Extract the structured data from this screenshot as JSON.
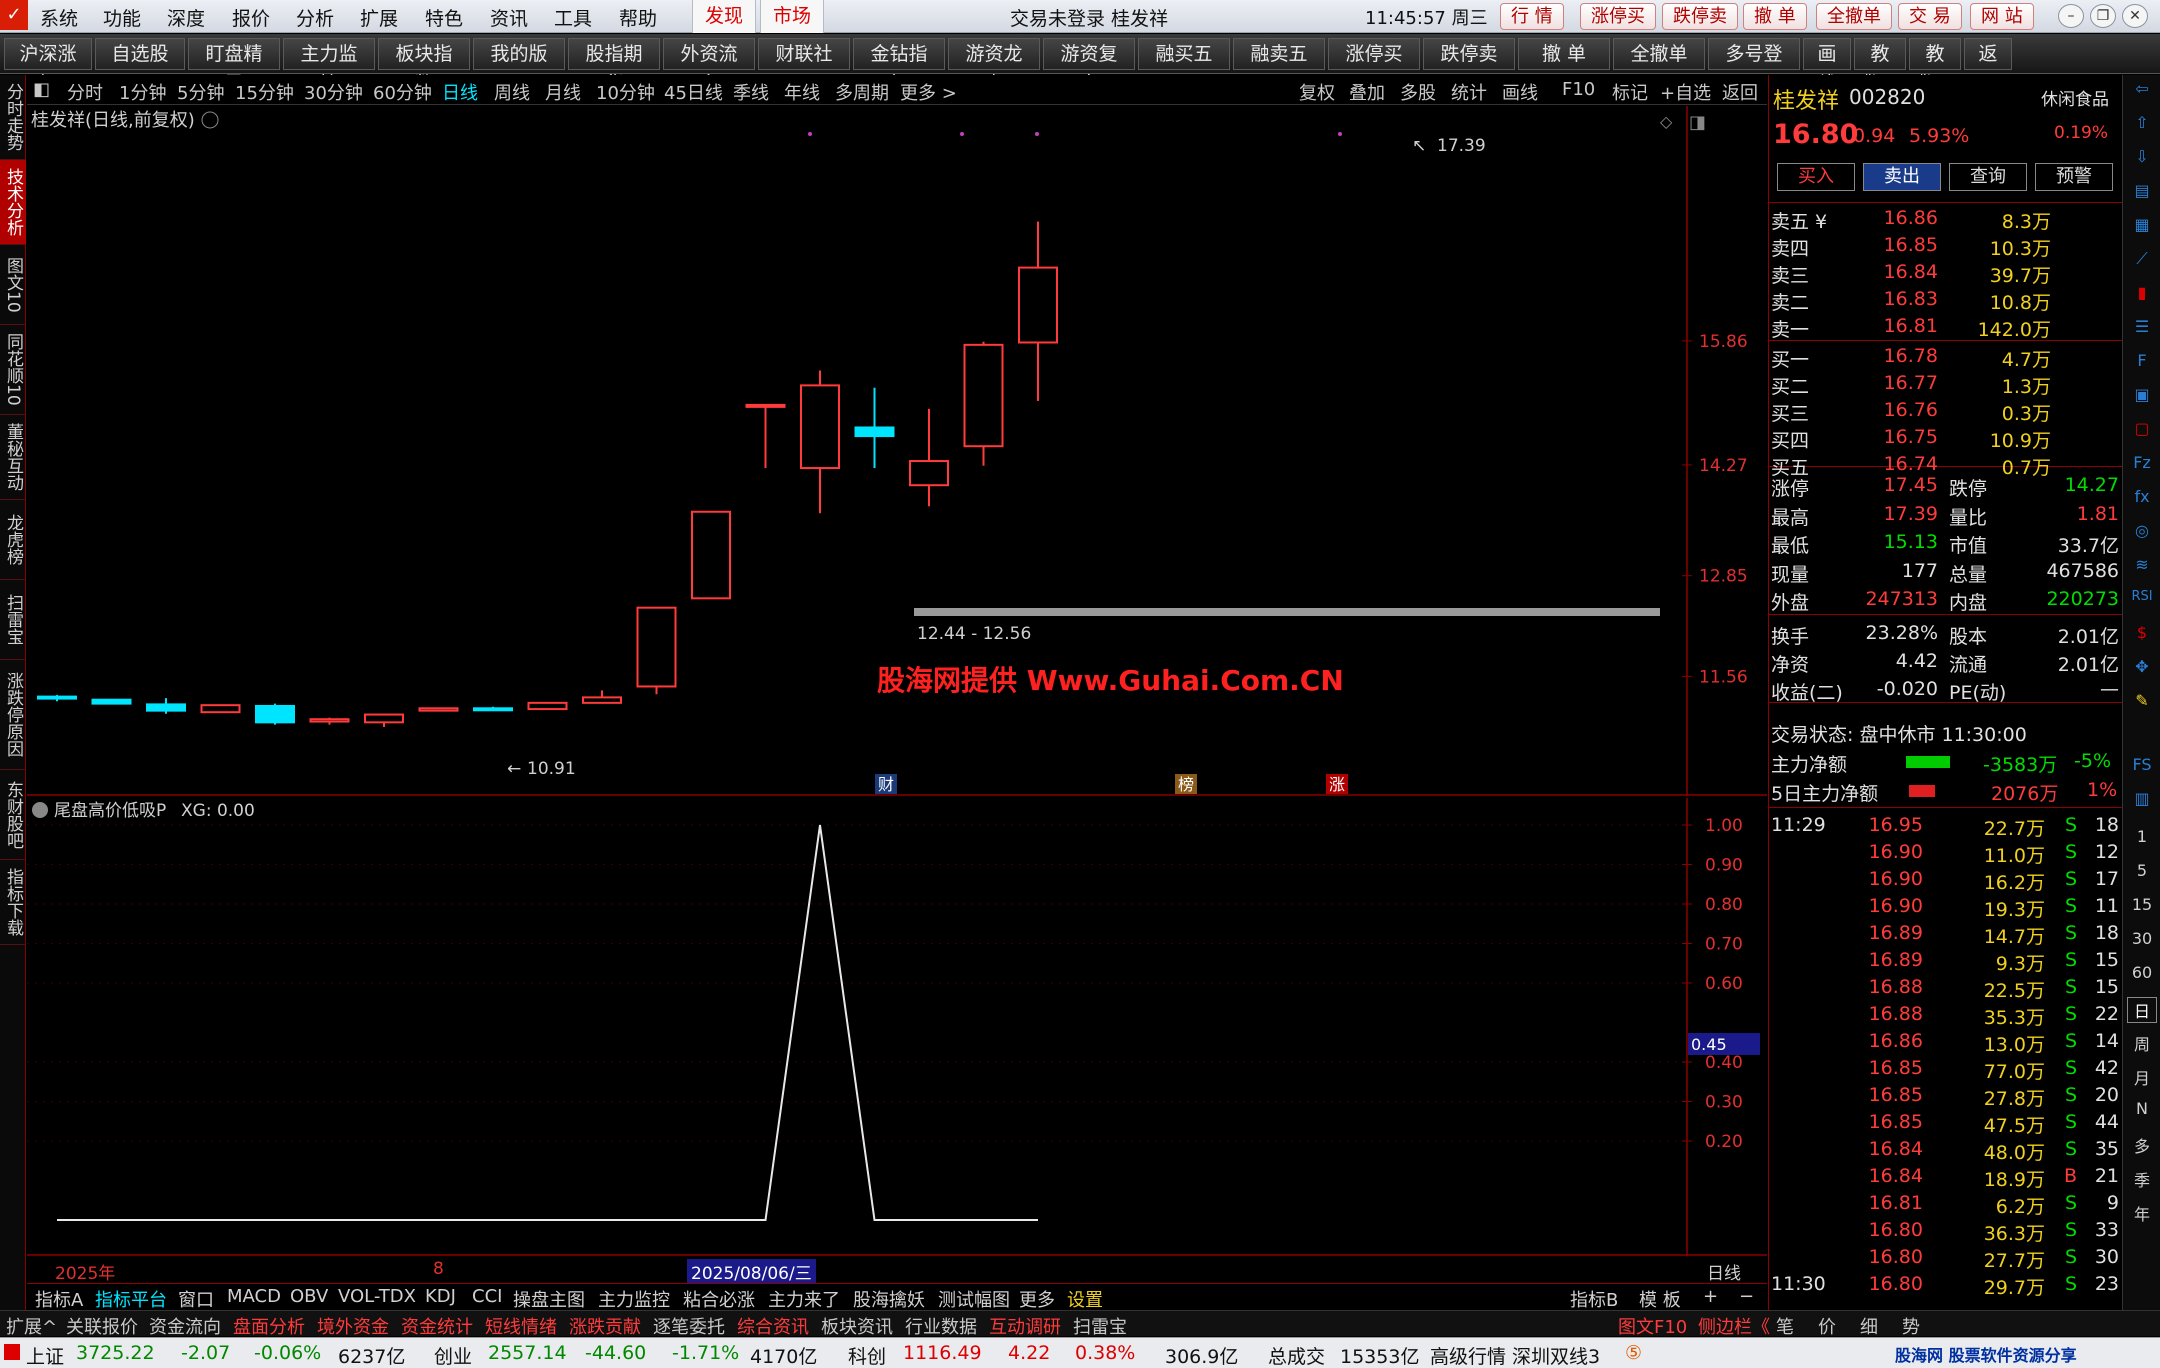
{
  "menubar": {
    "items": [
      "系统",
      "功能",
      "深度",
      "报价",
      "分析",
      "扩展",
      "特色",
      "资讯",
      "工具",
      "帮助"
    ],
    "highlight": [
      "发现",
      "市场"
    ],
    "center": "交易未登录  桂发祥",
    "clock": "11:45:57 周三",
    "trade_buttons": [
      "行  情",
      "涨停买",
      "跌停卖",
      "撤  单",
      "全撤单",
      "交  易",
      "网  站"
    ]
  },
  "toolbar": {
    "buttons": [
      "沪深涨幅",
      "自选股",
      "盯盘精灵",
      "主力监控",
      "板块指数",
      "我的版面",
      "股指期货",
      "外资流向",
      "财联社",
      "金钻指标",
      "游资龙虎",
      "游资复盘",
      "融买五",
      "融卖五",
      "涨停买",
      "跌停卖",
      "撤  单",
      "全撤单",
      "多号登录",
      "画线",
      "教鞭A",
      "教鞭B",
      "返回"
    ]
  },
  "left_tabs": [
    "分时走势",
    "技术分析",
    "图文10",
    "同花顺10",
    "董秘互动",
    "龙虎榜",
    "扫雷宝",
    "涨跌停原因",
    "东财股吧",
    "指标下载"
  ],
  "period_bar": {
    "periods": [
      "分时",
      "1分钟",
      "5分钟",
      "15分钟",
      "30分钟",
      "60分钟",
      "日线",
      "周线",
      "月线",
      "10分钟",
      "45日线",
      "季线",
      "年线",
      "多周期",
      "更多 >"
    ],
    "selected": "日线",
    "right": [
      "复权",
      "叠加",
      "多股",
      "统计",
      "画线",
      "F10",
      "标记",
      "+自选",
      "返回"
    ]
  },
  "main_chart": {
    "title": "桂发祥(日线,前复权)",
    "watermark": "股海网提供 Www.Guhai.Com.CN",
    "high_label": "17.39",
    "low_label": "10.91",
    "zone_label": "12.44 - 12.56",
    "markers": [
      "财",
      "榜",
      "涨"
    ],
    "y_ticks": [
      "15.86",
      "14.27",
      "12.85",
      "11.56"
    ]
  },
  "chart_data": {
    "type": "candlestick",
    "title": "桂发祥(日线,前复权)",
    "y_ticks": [
      15.86,
      14.27,
      12.85,
      11.56
    ],
    "candles": [
      {
        "o": 11.3,
        "h": 11.32,
        "l": 11.24,
        "c": 11.28,
        "color": "cyan"
      },
      {
        "o": 11.26,
        "h": 11.27,
        "l": 11.2,
        "c": 11.21,
        "color": "cyan"
      },
      {
        "o": 11.2,
        "h": 11.28,
        "l": 11.08,
        "c": 11.12,
        "color": "cyan"
      },
      {
        "o": 11.1,
        "h": 11.2,
        "l": 11.09,
        "c": 11.19,
        "color": "red"
      },
      {
        "o": 11.18,
        "h": 11.21,
        "l": 10.94,
        "c": 10.97,
        "color": "cyan"
      },
      {
        "o": 10.98,
        "h": 11.03,
        "l": 10.94,
        "c": 11.01,
        "color": "red"
      },
      {
        "o": 10.97,
        "h": 11.08,
        "l": 10.91,
        "c": 11.07,
        "color": "red"
      },
      {
        "o": 11.12,
        "h": 11.16,
        "l": 11.12,
        "c": 11.15,
        "color": "red"
      },
      {
        "o": 11.14,
        "h": 11.17,
        "l": 11.12,
        "c": 11.15,
        "color": "cyan"
      },
      {
        "o": 11.14,
        "h": 11.23,
        "l": 11.13,
        "c": 11.22,
        "color": "red"
      },
      {
        "o": 11.22,
        "h": 11.38,
        "l": 11.22,
        "c": 11.29,
        "color": "red"
      },
      {
        "o": 11.43,
        "h": 12.44,
        "l": 11.33,
        "c": 12.44,
        "color": "red"
      },
      {
        "o": 12.56,
        "h": 13.67,
        "l": 12.56,
        "c": 13.67,
        "color": "red"
      },
      {
        "o": 15.04,
        "h": 15.04,
        "l": 14.23,
        "c": 15.04,
        "color": "red"
      },
      {
        "o": 14.23,
        "h": 15.48,
        "l": 13.65,
        "c": 15.29,
        "color": "red"
      },
      {
        "o": 14.75,
        "h": 15.26,
        "l": 14.23,
        "c": 14.64,
        "color": "cyan"
      },
      {
        "o": 14.01,
        "h": 14.99,
        "l": 13.74,
        "c": 14.32,
        "color": "red"
      },
      {
        "o": 14.51,
        "h": 15.85,
        "l": 14.26,
        "c": 15.81,
        "color": "red"
      },
      {
        "o": 15.84,
        "h": 17.39,
        "l": 15.09,
        "c": 16.8,
        "color": "red"
      }
    ],
    "indicator": {
      "name": "尾盘高价低吸P",
      "label": "XG: 0.00",
      "y_ticks": [
        1.0,
        0.9,
        0.8,
        0.7,
        0.6,
        0.4,
        0.3,
        0.2
      ],
      "current": "0.45",
      "values": [
        0,
        0,
        0,
        0,
        0,
        0,
        0,
        0,
        0,
        0,
        0,
        0,
        0,
        0,
        1,
        0,
        0,
        0,
        0
      ]
    },
    "x_labels": [
      "2025年",
      "8",
      "2025/08/06/三"
    ]
  },
  "indicator_tabs": [
    "指标A",
    "指标平台",
    "窗口",
    "MACD",
    "OBV",
    "VOL-TDX",
    "KDJ",
    "CCI",
    "操盘主图",
    "主力监控",
    "粘合必涨",
    "主力来了",
    "股海擒妖",
    "测试幅图",
    "更多",
    "设置"
  ],
  "indicator_tabs_right": [
    "指标B",
    "模 板",
    "+",
    "−"
  ],
  "function_tabs": [
    "扩展^",
    "关联报价",
    "资金流向",
    "盘面分析",
    "境外资金",
    "资金统计",
    "短线情绪",
    "涨跌贡献",
    "逐笔委托",
    "综合资讯",
    "板块资讯",
    "行业数据",
    "互动调研",
    "扫雷宝"
  ],
  "function_tabs_right": [
    "图文F10",
    "侧边栏《",
    "笔",
    "价",
    "细",
    "势"
  ],
  "status_bar": {
    "sh_name": "上证",
    "sh_val": "3725.22",
    "sh_chg": "-2.07",
    "sh_pct": "-0.06%",
    "sh_amt": "6237亿",
    "cy_name": "创业",
    "cy_val": "2557.14",
    "cy_chg": "-44.60",
    "cy_pct": "-1.71%",
    "cy_amt": "4170亿",
    "kc_name": "科创",
    "kc_val": "1116.49",
    "kc_chg": "4.22",
    "kc_pct": "0.38%",
    "kc_amt": "306.9亿",
    "total_label": "总成交",
    "total_val": "15353亿",
    "feed": "高级行情  深圳双线3",
    "brand": "股海网  股票软件资源分享  www.Guhai.com.cn"
  },
  "quote": {
    "name": "桂发祥",
    "code": "002820",
    "sector": "休闲食品",
    "sector_pct": "0.19%",
    "price": "16.80",
    "change": "0.94",
    "pct": "5.93%",
    "buttons": [
      "买入",
      "卖出",
      "查询",
      "预警"
    ],
    "asks": [
      {
        "label": "卖五 ¥",
        "price": "16.86",
        "vol": "8.3万"
      },
      {
        "label": "卖四",
        "price": "16.85",
        "vol": "10.3万"
      },
      {
        "label": "卖三",
        "price": "16.84",
        "vol": "39.7万"
      },
      {
        "label": "卖二",
        "price": "16.83",
        "vol": "10.8万"
      },
      {
        "label": "卖一",
        "price": "16.81",
        "vol": "142.0万"
      }
    ],
    "bids": [
      {
        "label": "买一",
        "price": "16.78",
        "vol": "4.7万"
      },
      {
        "label": "买二",
        "price": "16.77",
        "vol": "1.3万"
      },
      {
        "label": "买三",
        "price": "16.76",
        "vol": "0.3万"
      },
      {
        "label": "买四",
        "price": "16.75",
        "vol": "10.9万"
      },
      {
        "label": "买五",
        "price": "16.74",
        "vol": "0.7万"
      }
    ],
    "stats": [
      {
        "k1": "涨停",
        "v1": "17.45",
        "c1": "red",
        "k2": "跌停",
        "v2": "14.27",
        "c2": "green"
      },
      {
        "k1": "最高",
        "v1": "17.39",
        "c1": "red",
        "k2": "量比",
        "v2": "1.81",
        "c2": "red"
      },
      {
        "k1": "最低",
        "v1": "15.13",
        "c1": "green",
        "k2": "市值",
        "v2": "33.7亿",
        "c2": "white"
      },
      {
        "k1": "现量",
        "v1": "177",
        "c1": "white",
        "k2": "总量",
        "v2": "467586",
        "c2": "white"
      },
      {
        "k1": "外盘",
        "v1": "247313",
        "c1": "red",
        "k2": "内盘",
        "v2": "220273",
        "c2": "green"
      }
    ],
    "stats2": [
      {
        "k1": "换手",
        "v1": "23.28%",
        "k2": "股本",
        "v2": "2.01亿"
      },
      {
        "k1": "净资",
        "v1": "4.42",
        "k2": "流通",
        "v2": "2.01亿"
      },
      {
        "k1": "收益(二)",
        "v1": "-0.020",
        "k2": "PE(动)",
        "v2": "—"
      }
    ],
    "trade_status": "交易状态: 盘中休市 11:30:00",
    "main_net": {
      "label": "主力净额",
      "val": "-3583万",
      "pct": "-5%"
    },
    "main_net5": {
      "label": "5日主力净额",
      "val": "2076万",
      "pct": "1%"
    },
    "ticks": [
      {
        "t": "11:29",
        "p": "16.95",
        "v": "22.7万",
        "s": "S",
        "n": "18"
      },
      {
        "t": "",
        "p": "16.90",
        "v": "11.0万",
        "s": "S",
        "n": "12"
      },
      {
        "t": "",
        "p": "16.90",
        "v": "16.2万",
        "s": "S",
        "n": "17"
      },
      {
        "t": "",
        "p": "16.90",
        "v": "19.3万",
        "s": "S",
        "n": "11"
      },
      {
        "t": "",
        "p": "16.89",
        "v": "14.7万",
        "s": "S",
        "n": "18"
      },
      {
        "t": "",
        "p": "16.89",
        "v": "9.3万",
        "s": "S",
        "n": "15"
      },
      {
        "t": "",
        "p": "16.88",
        "v": "22.5万",
        "s": "S",
        "n": "15"
      },
      {
        "t": "",
        "p": "16.88",
        "v": "35.3万",
        "s": "S",
        "n": "22"
      },
      {
        "t": "",
        "p": "16.86",
        "v": "13.0万",
        "s": "S",
        "n": "14"
      },
      {
        "t": "",
        "p": "16.85",
        "v": "77.0万",
        "s": "S",
        "n": "42"
      },
      {
        "t": "",
        "p": "16.85",
        "v": "27.8万",
        "s": "S",
        "n": "20"
      },
      {
        "t": "",
        "p": "16.85",
        "v": "47.5万",
        "s": "S",
        "n": "44"
      },
      {
        "t": "",
        "p": "16.84",
        "v": "48.0万",
        "s": "S",
        "n": "35"
      },
      {
        "t": "",
        "p": "16.84",
        "v": "18.9万",
        "s": "B",
        "n": "21"
      },
      {
        "t": "",
        "p": "16.81",
        "v": "6.2万",
        "s": "S",
        "n": "9"
      },
      {
        "t": "",
        "p": "16.80",
        "v": "36.3万",
        "s": "S",
        "n": "33"
      },
      {
        "t": "",
        "p": "16.80",
        "v": "27.7万",
        "s": "S",
        "n": "30"
      },
      {
        "t": "11:30",
        "p": "16.80",
        "v": "29.7万",
        "s": "S",
        "n": "23"
      }
    ]
  },
  "right_icons": [
    "1",
    "5",
    "15",
    "30",
    "60",
    "日",
    "周",
    "月",
    "N",
    "多",
    "季",
    "年"
  ],
  "colors": {
    "up": "#ff3b3b",
    "down": "#00e5ff",
    "bg": "#000000",
    "grid": "#8b0000"
  }
}
